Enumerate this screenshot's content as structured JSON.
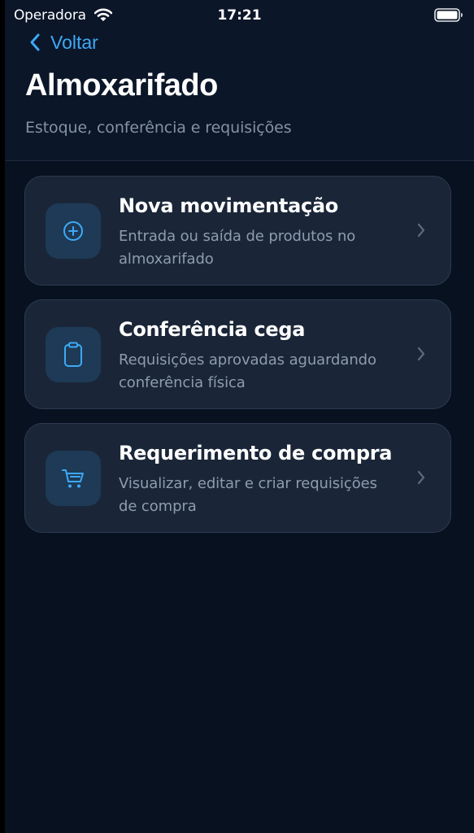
{
  "status_bar": {
    "carrier": "Operadora",
    "time": "17:21"
  },
  "header": {
    "back_label": "Voltar",
    "title": "Almoxarifado",
    "subtitle": "Estoque, conferência e requisições"
  },
  "menu": {
    "items": [
      {
        "icon": "plus-circle-icon",
        "title": "Nova movimentação",
        "description": "Entrada ou saída de produtos no almoxarifado"
      },
      {
        "icon": "clipboard-icon",
        "title": "Conferência cega",
        "description": "Requisições aprovadas aguardando conferência física"
      },
      {
        "icon": "cart-icon",
        "title": "Requerimento de compra",
        "description": "Visualizar, editar e criar requisições de compra"
      }
    ]
  },
  "colors": {
    "background": "#07111f",
    "header_background": "#0b1629",
    "card_background": "#1a2638",
    "icon_tile": "#1e3a56",
    "accent": "#3ea9f5",
    "secondary_text": "#8e9bb0"
  }
}
